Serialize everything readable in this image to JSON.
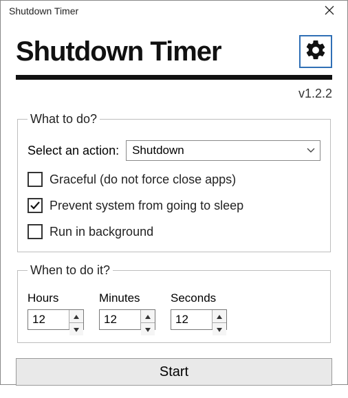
{
  "window": {
    "title": "Shutdown Timer"
  },
  "header": {
    "appTitle": "Shutdown Timer",
    "version": "v1.2.2"
  },
  "whatToDo": {
    "legend": "What to do?",
    "selectLabel": "Select an action:",
    "selectedAction": "Shutdown",
    "gracefulLabel": "Graceful (do not force close apps)",
    "gracefulChecked": false,
    "preventSleepLabel": "Prevent system from going to sleep",
    "preventSleepChecked": true,
    "runBackgroundLabel": "Run in background",
    "runBackgroundChecked": false
  },
  "whenToDo": {
    "legend": "When to do it?",
    "hoursLabel": "Hours",
    "minutesLabel": "Minutes",
    "secondsLabel": "Seconds",
    "hours": "12",
    "minutes": "12",
    "seconds": "12"
  },
  "startLabel": "Start"
}
